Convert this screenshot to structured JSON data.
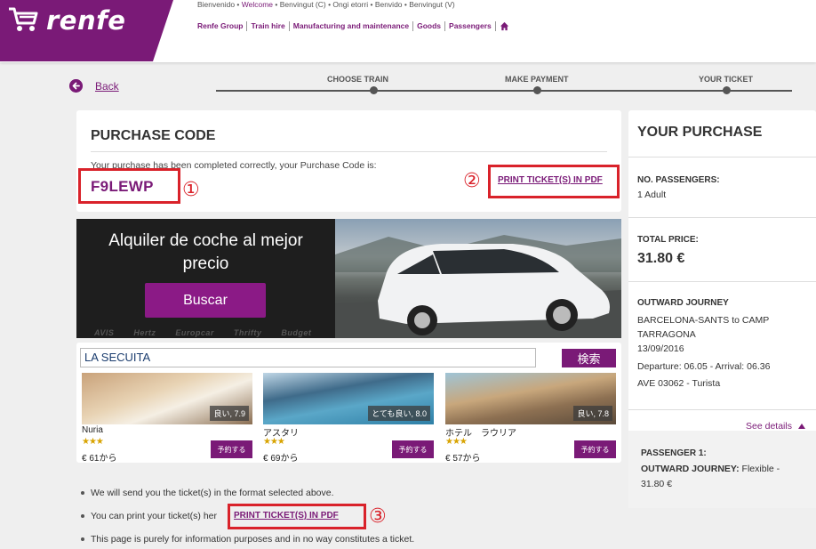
{
  "header": {
    "brand": "renfe",
    "lang_links": [
      {
        "label": "Bienvenido",
        "active": false
      },
      {
        "label": "Welcome",
        "active": true
      },
      {
        "label": "Benvingut (C)",
        "active": false
      },
      {
        "label": "Ongi etorri",
        "active": false
      },
      {
        "label": "Benvido",
        "active": false
      },
      {
        "label": "Benvingut (V)",
        "active": false
      }
    ],
    "separator": " • ",
    "group_nav": [
      "Renfe Group",
      "Train hire",
      "Manufacturing and maintenance",
      "Goods",
      "Passengers"
    ]
  },
  "nav": {
    "back_label": "Back",
    "steps": [
      "CHOOSE TRAIN",
      "MAKE PAYMENT",
      "YOUR TICKET"
    ]
  },
  "purchase": {
    "title": "PURCHASE CODE",
    "message": "Your purchase has been completed correctly, your Purchase Code is:",
    "code": "F9LEWP",
    "print_label": "PRINT TICKET(S) IN PDF"
  },
  "annotations": {
    "one": "①",
    "two": "②",
    "three": "③"
  },
  "ad": {
    "line1": "Alquiler de coche al mejor",
    "line2": "precio",
    "button": "Buscar",
    "logos": [
      "AVIS",
      "Hertz",
      "Europcar",
      "Thrifty",
      "Budget"
    ]
  },
  "hotels": {
    "search_value": "LA SECUITA",
    "search_button": "検索",
    "items": [
      {
        "name": "Nuria",
        "rating": "良い, 7.9",
        "stars": "★★★",
        "price": "€ 61から",
        "book": "予約する"
      },
      {
        "name": "アスタリ",
        "rating": "とても良い, 8.0",
        "stars": "★★★",
        "price": "€ 69から",
        "book": "予約する"
      },
      {
        "name": "ホテル　ラウリア",
        "rating": "良い, 7.8",
        "stars": "★★★",
        "price": "€ 57から",
        "book": "予約する"
      }
    ]
  },
  "notes": {
    "line1": "We will send you the ticket(s) in the format selected above.",
    "line2": "You can print your ticket(s) her",
    "line2_link": "PRINT TICKET(S) IN PDF",
    "line3": "This page is purely for information purposes and in no way constitutes a ticket."
  },
  "summary": {
    "title": "YOUR PURCHASE",
    "passengers_label": "NO. PASSENGERS:",
    "passengers_value": "1 Adult",
    "price_label": "TOTAL PRICE:",
    "price_value": "31.80 €",
    "journey_label": "OUTWARD JOURNEY",
    "journey_route_1": "BARCELONA-SANTS to CAMP",
    "journey_route_2": "TARRAGONA",
    "journey_date": "13/09/2016",
    "journey_times": "Departure: 06.05 - Arrival: 06.36",
    "journey_train": "AVE 03062 - Turista",
    "see_details": "See details",
    "passenger_label": "PASSENGER 1:",
    "passenger_journey_label": "OUTWARD JOURNEY:",
    "passenger_fare": " Flexible -",
    "passenger_price": "31.80 €"
  },
  "colors": {
    "brand": "#7a1a77",
    "annotation": "#d9222a"
  }
}
